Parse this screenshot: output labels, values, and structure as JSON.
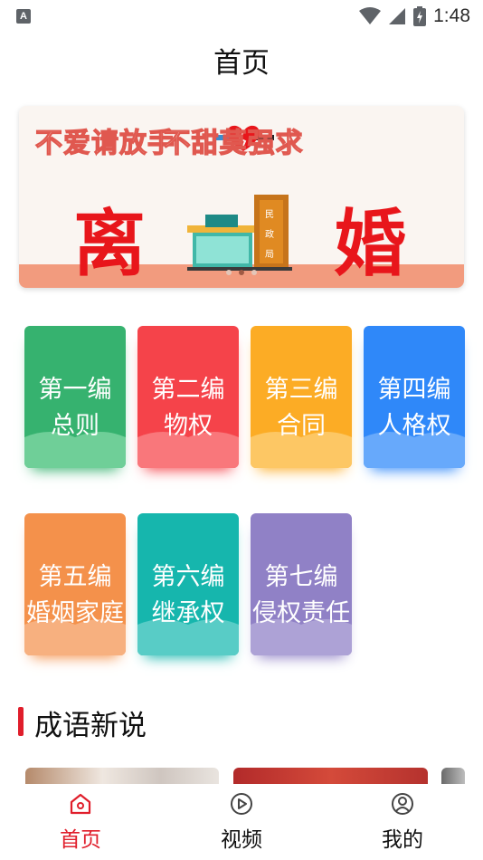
{
  "status_bar": {
    "time": "1:48",
    "notification_icon": "A"
  },
  "header": {
    "title": "首页"
  },
  "banner": {
    "slogan_left": "不爱请放手",
    "slogan_right": "不甜莫强求",
    "headline_left": "离",
    "headline_right": "婚",
    "building_sign": "民政局",
    "slides": 3,
    "active_slide": 2
  },
  "categories": [
    {
      "line1": "第一编",
      "line2": "总则",
      "color": "#36b26f",
      "wave": "#6fcf98"
    },
    {
      "line1": "第二编",
      "line2": "物权",
      "color": "#f5434a",
      "wave": "#f9777b"
    },
    {
      "line1": "第三编",
      "line2": "合同",
      "color": "#fcac25",
      "wave": "#fdc764"
    },
    {
      "line1": "第四编",
      "line2": "人格权",
      "color": "#2f88f9",
      "wave": "#67a9fb"
    },
    {
      "line1": "第五编",
      "line2": "婚姻家庭",
      "color": "#f4914b",
      "wave": "#f7b07f"
    },
    {
      "line1": "第六编",
      "line2": "继承权",
      "color": "#16b6ad",
      "wave": "#58ccc6"
    },
    {
      "line1": "第七编",
      "line2": "侵权责任",
      "color": "#9081c6",
      "wave": "#ada2d6"
    }
  ],
  "section": {
    "title": "成语新说"
  },
  "nav": [
    {
      "label": "首页",
      "icon": "home-icon",
      "active": true
    },
    {
      "label": "视频",
      "icon": "video-icon",
      "active": false
    },
    {
      "label": "我的",
      "icon": "profile-icon",
      "active": false
    }
  ],
  "colors": {
    "accent": "#e01e2b"
  }
}
